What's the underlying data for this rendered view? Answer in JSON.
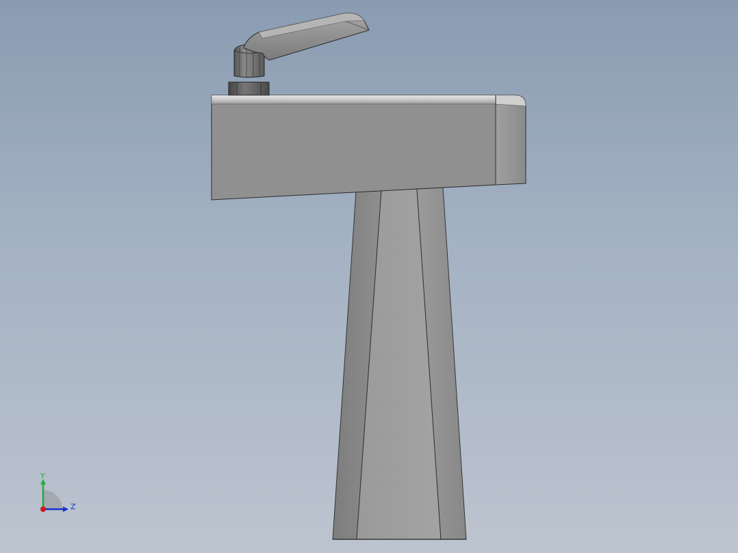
{
  "viewport": {
    "background_top": "#8a9cb2",
    "background_bottom": "#bcc4cf",
    "model_color": "#909090"
  },
  "triad": {
    "y_label": "Y",
    "z_label": "Z",
    "y_color": "#1fae3a",
    "z_color": "#1b2fd0",
    "x_color": "#d01818"
  },
  "model": {
    "parts": [
      "lever-handle",
      "collar-nut",
      "top-body",
      "tapered-pedestal"
    ]
  }
}
